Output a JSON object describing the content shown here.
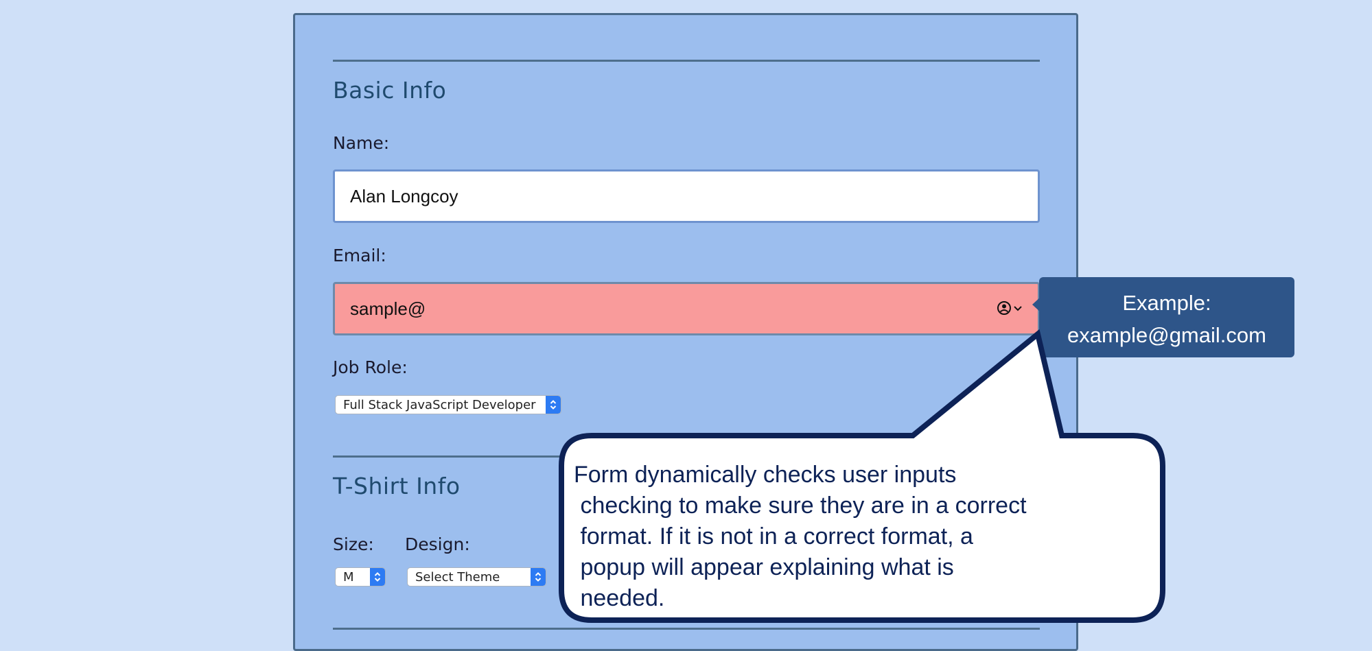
{
  "form": {
    "basic_info": {
      "title": "Basic Info",
      "name_label": "Name:",
      "name_value": "Alan Longcoy",
      "email_label": "Email:",
      "email_value": "sample@",
      "job_role_label": "Job Role:",
      "job_role_value": "Full Stack JavaScript Developer"
    },
    "tshirt_info": {
      "title": "T-Shirt Info",
      "size_label": "Size:",
      "size_value": "M",
      "design_label": "Design:",
      "design_value": "Select Theme"
    }
  },
  "tooltip": {
    "line1": "Example:",
    "line2": "example@gmail.com"
  },
  "callout": {
    "text": "Form dynamically checks user inputs\n checking to make sure they are in a correct\n format. If it is not in a correct format, a\n popup will appear explaining what is\n needed."
  },
  "icons": {
    "autofill": "contact-autofill-icon",
    "select_arrows": "select-arrows-icon"
  },
  "colors": {
    "page_background": "#cfe0f8",
    "card_background": "#9cbeee",
    "error_field": "#f99b9b",
    "tooltip_background": "#2e5589",
    "callout_border": "#0d2256",
    "select_accent": "#2d7bf3"
  }
}
